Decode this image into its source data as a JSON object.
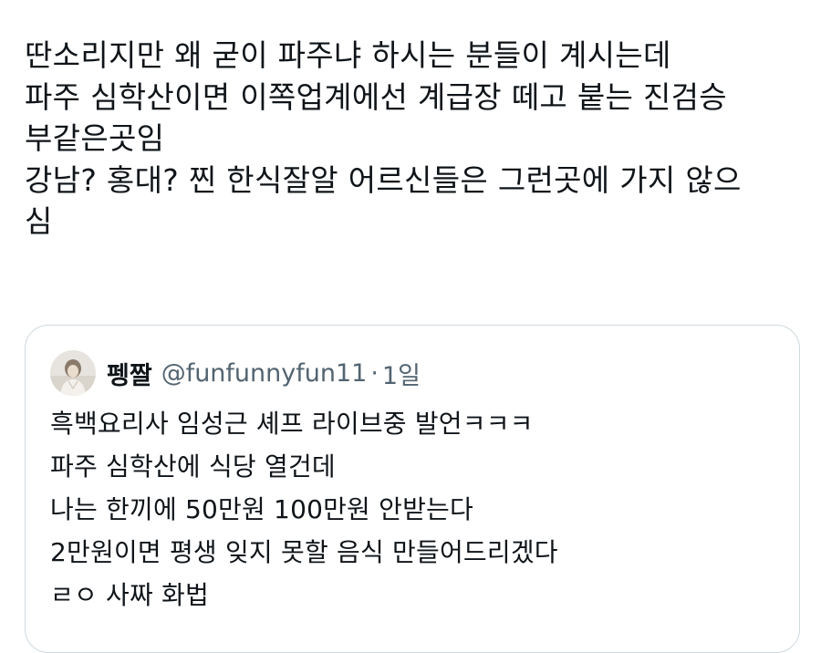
{
  "tweet": {
    "lines": [
      "딴소리지만 왜 굳이 파주냐 하시는 분들이 계시는데",
      "파주 심학산이면 이쪽업계에선 계급장 떼고 붙는 진검승",
      "부같은곳임",
      "강남? 홍대? 찐 한식잘알 어르신들은 그런곳에 가지 않으",
      "심"
    ]
  },
  "quote": {
    "display_name": "펭짤",
    "handle": "@funfunnyfun11",
    "separator": "·",
    "time": "1일",
    "lines": [
      "흑백요리사 임성근 셰프 라이브중 발언ㅋㅋㅋ",
      "파주 심학산에 식당 열건데",
      "나는 한끼에 50만원 100만원 안받는다",
      "2만원이면 평생 잊지 못할 음식 만들어드리겠다",
      "ㄹㅇ 사짜 화법"
    ]
  },
  "colors": {
    "text": "#0f1419",
    "secondary": "#536471",
    "border": "#cfd9de"
  },
  "icons": {
    "avatar": "profile-photo-avatar"
  }
}
